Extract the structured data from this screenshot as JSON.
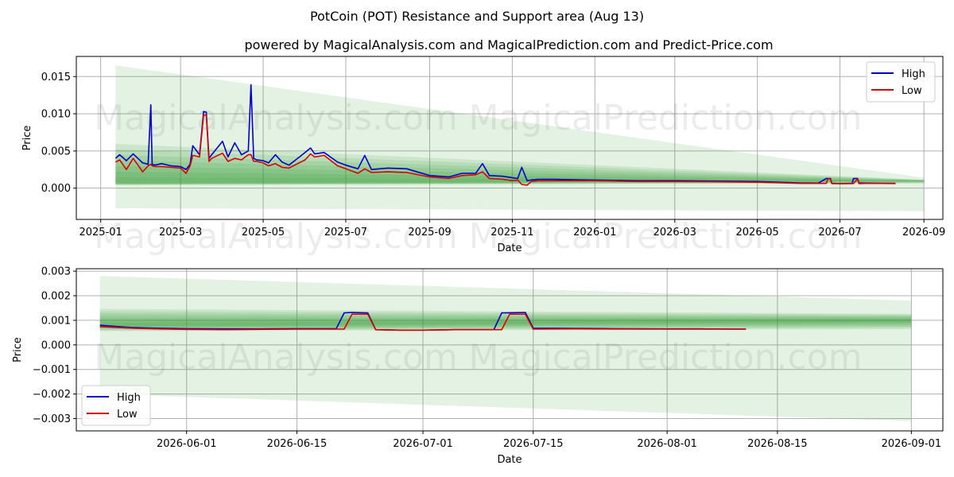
{
  "title": "PotCoin (POT) Resistance and Support area (Aug 13)",
  "subtitle": "powered by MagicalAnalysis.com and MagicalPrediction.com and Predict-Price.com",
  "watermark_left": "MagicalAnalysis.com",
  "watermark_right": "MagicalPrediction.com",
  "colors": {
    "high": "#0000cc",
    "low": "#dd0000",
    "band": "#2e9a2e",
    "grid": "#b0b0b0"
  },
  "chart_data": [
    {
      "type": "line",
      "xlabel": "Date",
      "ylabel": "Price",
      "x_ticks": [
        "2025-01",
        "2025-03",
        "2025-05",
        "2025-07",
        "2025-09",
        "2025-11",
        "2026-01",
        "2026-03",
        "2026-05",
        "2026-07",
        "2026-09"
      ],
      "y_ticks": [
        "0.000",
        "0.005",
        "0.010",
        "0.015"
      ],
      "xlim": [
        "2024-12-14",
        "2026-09-15"
      ],
      "ylim": [
        -0.0042,
        0.0177
      ],
      "grid": true,
      "legend": "top-right",
      "support_area": {
        "x": [
          "2025-01-12",
          "2026-09-01"
        ],
        "outer_top": [
          0.0165,
          0.0014
        ],
        "outer_bottom": [
          -0.0027,
          -0.0031
        ],
        "core": [
          0.0007,
          0.001
        ]
      },
      "series": [
        {
          "name": "High",
          "x": [
            "2025-01-12",
            "2025-01-15",
            "2025-01-20",
            "2025-01-25",
            "2025-02-01",
            "2025-02-05",
            "2025-02-07",
            "2025-02-08",
            "2025-02-10",
            "2025-02-15",
            "2025-02-22",
            "2025-03-01",
            "2025-03-05",
            "2025-03-08",
            "2025-03-10",
            "2025-03-15",
            "2025-03-18",
            "2025-03-20",
            "2025-03-22",
            "2025-03-24",
            "2025-04-01",
            "2025-04-05",
            "2025-04-10",
            "2025-04-15",
            "2025-04-20",
            "2025-04-22",
            "2025-04-24",
            "2025-04-26",
            "2025-05-01",
            "2025-05-05",
            "2025-05-10",
            "2025-05-15",
            "2025-05-20",
            "2025-06-01",
            "2025-06-05",
            "2025-06-08",
            "2025-06-15",
            "2025-06-25",
            "2025-07-01",
            "2025-07-10",
            "2025-07-15",
            "2025-07-20",
            "2025-08-01",
            "2025-08-15",
            "2025-09-01",
            "2025-09-15",
            "2025-09-25",
            "2025-10-05",
            "2025-10-10",
            "2025-10-15",
            "2025-10-25",
            "2025-11-01",
            "2025-11-05",
            "2025-11-08",
            "2025-11-12",
            "2025-11-15",
            "2025-11-20",
            "2025-12-01",
            "2026-01-01",
            "2026-02-01",
            "2026-03-01",
            "2026-04-01",
            "2026-05-01",
            "2026-05-21",
            "2026-06-01",
            "2026-06-15",
            "2026-06-21",
            "2026-06-22",
            "2026-06-24",
            "2026-06-25",
            "2026-07-01",
            "2026-07-10",
            "2026-07-11",
            "2026-07-14",
            "2026-07-15",
            "2026-07-20",
            "2026-08-01",
            "2026-08-11"
          ],
          "values": [
            0.004,
            0.0045,
            0.0037,
            0.0046,
            0.0034,
            0.0032,
            0.0112,
            0.0032,
            0.0031,
            0.0033,
            0.003,
            0.0029,
            0.0025,
            0.0032,
            0.0057,
            0.0045,
            0.0103,
            0.0102,
            0.004,
            0.0045,
            0.0063,
            0.0042,
            0.0061,
            0.0045,
            0.005,
            0.0139,
            0.004,
            0.0038,
            0.0037,
            0.0034,
            0.0045,
            0.0035,
            0.0031,
            0.0048,
            0.0054,
            0.0046,
            0.0048,
            0.0035,
            0.0031,
            0.0026,
            0.0044,
            0.0025,
            0.0027,
            0.0026,
            0.0017,
            0.0015,
            0.002,
            0.002,
            0.0033,
            0.0017,
            0.0016,
            0.0014,
            0.0013,
            0.0028,
            0.001,
            0.0011,
            0.0012,
            0.0012,
            0.0011,
            0.001,
            0.001,
            0.00095,
            0.0009,
            0.00078,
            0.0007,
            0.00068,
            0.0013,
            0.0013,
            0.0013,
            0.00065,
            0.00062,
            0.00065,
            0.0013,
            0.0013,
            0.0007,
            0.00068,
            0.00066,
            0.00065
          ]
        },
        {
          "name": "Low",
          "x": [
            "2025-01-12",
            "2025-01-15",
            "2025-01-20",
            "2025-01-25",
            "2025-02-01",
            "2025-02-05",
            "2025-02-07",
            "2025-02-08",
            "2025-02-10",
            "2025-02-15",
            "2025-02-22",
            "2025-03-01",
            "2025-03-05",
            "2025-03-08",
            "2025-03-10",
            "2025-03-15",
            "2025-03-18",
            "2025-03-20",
            "2025-03-22",
            "2025-03-24",
            "2025-04-01",
            "2025-04-05",
            "2025-04-10",
            "2025-04-15",
            "2025-04-20",
            "2025-04-22",
            "2025-04-24",
            "2025-04-26",
            "2025-05-01",
            "2025-05-05",
            "2025-05-10",
            "2025-05-15",
            "2025-05-20",
            "2025-06-01",
            "2025-06-05",
            "2025-06-08",
            "2025-06-15",
            "2025-06-25",
            "2025-07-01",
            "2025-07-10",
            "2025-07-15",
            "2025-07-20",
            "2025-08-01",
            "2025-08-15",
            "2025-09-01",
            "2025-09-15",
            "2025-09-25",
            "2025-10-05",
            "2025-10-10",
            "2025-10-15",
            "2025-10-25",
            "2025-11-01",
            "2025-11-05",
            "2025-11-08",
            "2025-11-12",
            "2025-11-15",
            "2025-11-20",
            "2025-12-01",
            "2026-01-01",
            "2026-02-01",
            "2026-03-01",
            "2026-04-01",
            "2026-05-01",
            "2026-05-21",
            "2026-06-01",
            "2026-06-15",
            "2026-06-21",
            "2026-06-22",
            "2026-06-24",
            "2026-06-25",
            "2026-07-01",
            "2026-07-10",
            "2026-07-11",
            "2026-07-14",
            "2026-07-15",
            "2026-07-20",
            "2026-08-01",
            "2026-08-11"
          ],
          "values": [
            0.0035,
            0.0038,
            0.0025,
            0.004,
            0.0022,
            0.003,
            0.0032,
            0.003,
            0.0029,
            0.0029,
            0.0028,
            0.0027,
            0.002,
            0.003,
            0.0044,
            0.0042,
            0.0098,
            0.0098,
            0.0036,
            0.004,
            0.0047,
            0.0036,
            0.004,
            0.0038,
            0.0045,
            0.0045,
            0.0036,
            0.0036,
            0.0034,
            0.003,
            0.0033,
            0.0028,
            0.0027,
            0.0038,
            0.0046,
            0.0042,
            0.0044,
            0.003,
            0.0026,
            0.002,
            0.0026,
            0.0021,
            0.0022,
            0.0021,
            0.0015,
            0.0013,
            0.0017,
            0.0018,
            0.0022,
            0.0013,
            0.0012,
            0.001,
            0.0011,
            0.0005,
            0.0004,
            0.0009,
            0.001,
            0.001,
            0.001,
            0.0009,
            0.0009,
            0.00085,
            0.0008,
            0.0007,
            0.00064,
            0.00064,
            0.00064,
            0.00125,
            0.00125,
            0.00062,
            0.0006,
            0.00062,
            0.00062,
            0.00125,
            0.00062,
            0.00064,
            0.00064,
            0.00062
          ]
        }
      ]
    },
    {
      "type": "line",
      "xlabel": "Date",
      "ylabel": "Price",
      "x_ticks": [
        "2026-06-01",
        "2026-06-15",
        "2026-07-01",
        "2026-07-15",
        "2026-08-01",
        "2026-08-15",
        "2026-09-01"
      ],
      "y_ticks": [
        "−0.003",
        "−0.002",
        "−0.001",
        "0.000",
        "0.001",
        "0.002",
        "0.003"
      ],
      "xlim": [
        "2026-05-18",
        "2026-09-05"
      ],
      "ylim": [
        -0.0035,
        0.0031
      ],
      "grid": true,
      "legend": "bottom-left",
      "support_area": {
        "x": [
          "2026-05-21",
          "2026-09-01"
        ],
        "outer_top": [
          0.0028,
          0.0018
        ],
        "outer_bottom": [
          -0.002,
          -0.0031
        ],
        "core": [
          0.0008,
          0.001
        ]
      },
      "series": [
        {
          "name": "High",
          "x": [
            "2026-05-21",
            "2026-05-23",
            "2026-05-25",
            "2026-05-28",
            "2026-06-01",
            "2026-06-06",
            "2026-06-10",
            "2026-06-15",
            "2026-06-20",
            "2026-06-21",
            "2026-06-22",
            "2026-06-24",
            "2026-06-25",
            "2026-06-28",
            "2026-07-01",
            "2026-07-05",
            "2026-07-10",
            "2026-07-11",
            "2026-07-14",
            "2026-07-15",
            "2026-07-20",
            "2026-07-25",
            "2026-08-01",
            "2026-08-05",
            "2026-08-11"
          ],
          "values": [
            0.0008,
            0.00075,
            0.00071,
            0.00068,
            0.00066,
            0.00065,
            0.00065,
            0.00066,
            0.00066,
            0.0013,
            0.00132,
            0.0013,
            0.00062,
            0.0006,
            0.0006,
            0.00062,
            0.00062,
            0.0013,
            0.00132,
            0.00068,
            0.00067,
            0.00066,
            0.00065,
            0.00065,
            0.00064
          ]
        },
        {
          "name": "Low",
          "x": [
            "2026-05-21",
            "2026-05-25",
            "2026-05-28",
            "2026-06-01",
            "2026-06-06",
            "2026-06-10",
            "2026-06-15",
            "2026-06-21",
            "2026-06-22",
            "2026-06-24",
            "2026-06-25",
            "2026-06-28",
            "2026-07-01",
            "2026-07-05",
            "2026-07-10",
            "2026-07-11",
            "2026-07-12",
            "2026-07-14",
            "2026-07-15",
            "2026-07-20",
            "2026-08-01",
            "2026-08-05",
            "2026-08-11"
          ],
          "values": [
            0.00074,
            0.00068,
            0.00065,
            0.00063,
            0.00062,
            0.00063,
            0.00064,
            0.00064,
            0.00125,
            0.00125,
            0.00062,
            0.0006,
            0.0006,
            0.00062,
            0.00062,
            0.00062,
            0.00125,
            0.00125,
            0.00064,
            0.00065,
            0.00064,
            0.00064,
            0.00064
          ]
        }
      ]
    }
  ]
}
